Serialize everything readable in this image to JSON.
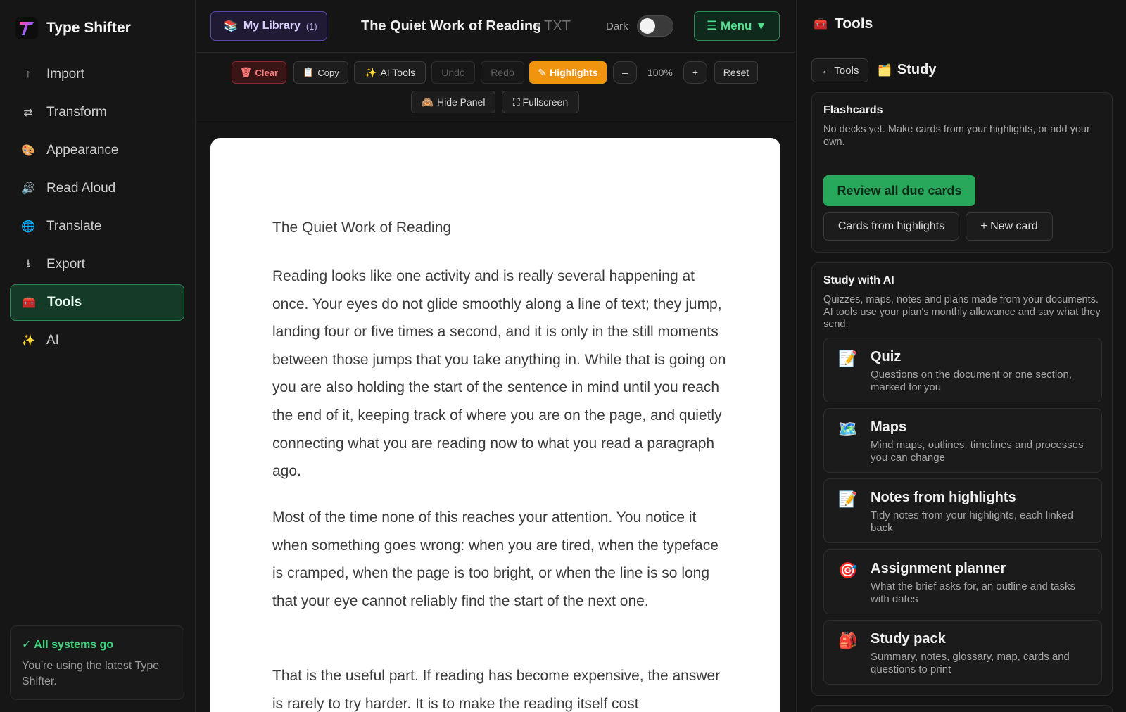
{
  "app": {
    "name": "Type Shifter"
  },
  "sidebar": {
    "items": [
      {
        "label": "Import",
        "icon": "↑"
      },
      {
        "label": "Transform",
        "icon": "⇄"
      },
      {
        "label": "Appearance",
        "icon": "🎨"
      },
      {
        "label": "Read Aloud",
        "icon": "🔊"
      },
      {
        "label": "Translate",
        "icon": "🌐"
      },
      {
        "label": "Export",
        "icon": "⭳"
      },
      {
        "label": "Tools",
        "icon": "🧰",
        "active": true
      },
      {
        "label": "AI",
        "icon": "✨"
      }
    ],
    "status": {
      "title": "✓ All systems go",
      "text": "You're using the latest Type Shifter."
    }
  },
  "header": {
    "library_label": "My Library",
    "library_count": "(1)",
    "doc_title": "The Quiet Work of Reading",
    "doc_type": "• TXT",
    "dark_label": "Dark",
    "dark_on": false,
    "menu_label": "☰ Menu ▼"
  },
  "toolbar": {
    "clear": "Clear",
    "copy": "Copy",
    "ai_tools": "AI Tools",
    "undo": "Undo",
    "redo": "Redo",
    "highlights": "Highlights",
    "zoom_out": "–",
    "zoom": "100%",
    "zoom_in": "+",
    "reset": "Reset",
    "hide_panel": "Hide Panel",
    "fullscreen": "⛶ Fullscreen"
  },
  "document": {
    "title": "The Quiet Work of Reading",
    "paragraphs": [
      "Reading looks like one activity and is really several happening at once. Your eyes do not glide smoothly along a line of text; they jump, landing four or five times a second, and it is only in the still moments between those jumps that you take anything in. While that is going on you are also holding the start of the sentence in mind until you reach the end of it, keeping track of where you are on the page, and quietly connecting what you are reading now to what you read a paragraph ago.",
      "Most of the time none of this reaches your attention. You notice it when something goes wrong: when you are tired, when the typeface is cramped, when the page is too bright, or when the line is so long that your eye cannot reliably find the start of the next one.",
      "That is the useful part. If reading has become expensive, the answer is rarely to try harder. It is to make the reading itself cost"
    ]
  },
  "panel": {
    "title": "Tools",
    "back": "← Tools",
    "section": "Study",
    "flashcards": {
      "title": "Flashcards",
      "desc": "No decks yet. Make cards from your highlights, or add your own.",
      "review": "Review all due cards",
      "from_highlights": "Cards from highlights",
      "new_card": "+ New card"
    },
    "study_ai": {
      "title": "Study with AI",
      "desc": "Quizzes, maps, notes and plans made from your documents. AI tools use your plan's monthly allowance and say what they send.",
      "tools": [
        {
          "icon": "📝",
          "title": "Quiz",
          "desc": "Questions on the document or one section, marked for you"
        },
        {
          "icon": "🗺️",
          "title": "Maps",
          "desc": "Mind maps, outlines, timelines and processes you can change"
        },
        {
          "icon": "📝",
          "title": "Notes from highlights",
          "desc": "Tidy notes from your highlights, each linked back"
        },
        {
          "icon": "🎯",
          "title": "Assignment planner",
          "desc": "What the brief asks for, an outline and tasks with dates"
        },
        {
          "icon": "🎒",
          "title": "Study pack",
          "desc": "Summary, notes, glossary, map, cards and questions to print"
        }
      ]
    }
  },
  "colors": {
    "accent_green": "#27a85a",
    "highlight_orange": "#f0940f",
    "library_purple": "#5a47a8",
    "clear_red": "#ff7a7a"
  }
}
